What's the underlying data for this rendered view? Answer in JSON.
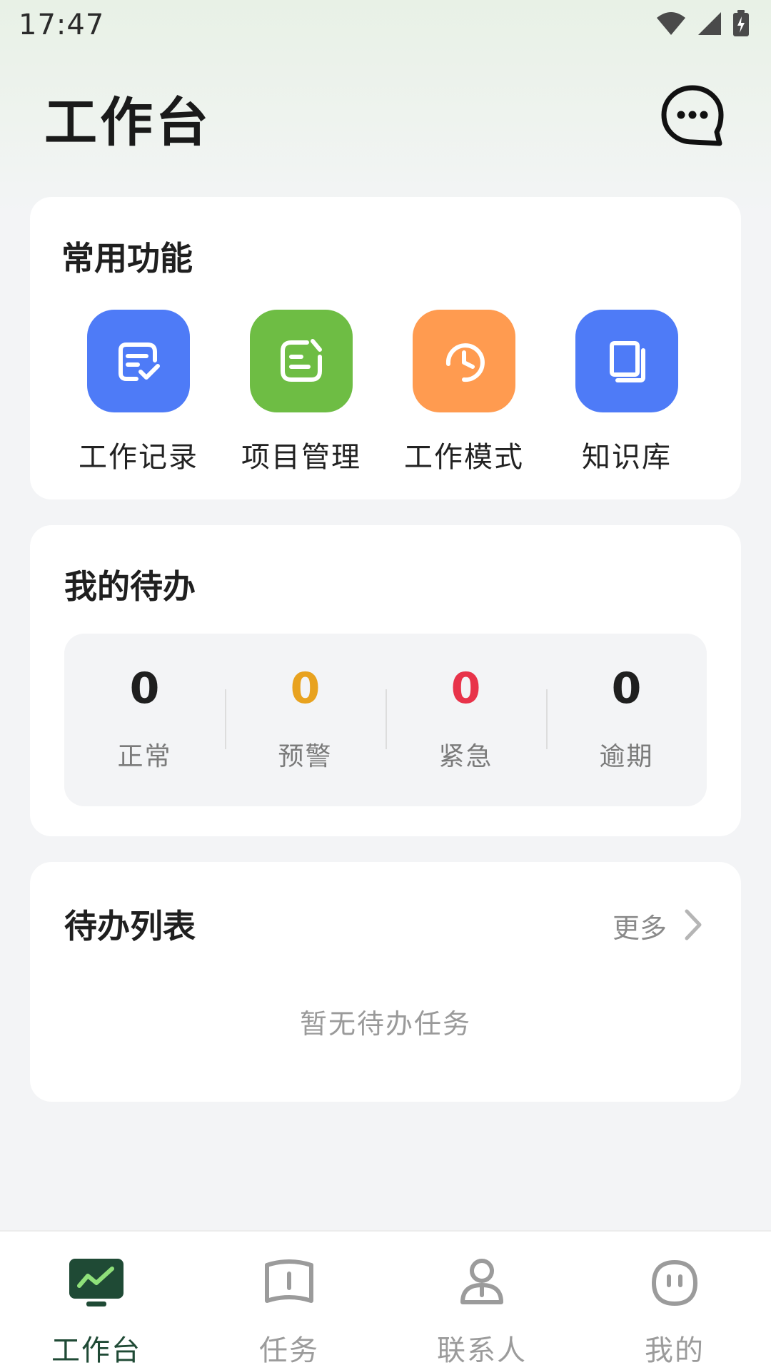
{
  "status_bar": {
    "time": "17:47"
  },
  "header": {
    "title": "工作台",
    "chat_icon": "chat-bubble-icon"
  },
  "functions": {
    "title": "常用功能",
    "items": [
      {
        "label": "工作记录",
        "icon": "record-check-icon",
        "color": "#4e7bf7"
      },
      {
        "label": "项目管理",
        "icon": "project-note-icon",
        "color": "#6ebd44"
      },
      {
        "label": "工作模式",
        "icon": "clock-icon",
        "color": "#ff9b50"
      },
      {
        "label": "知识库",
        "icon": "book-icon",
        "color": "#4e7bf7"
      }
    ]
  },
  "todo": {
    "title": "我的待办",
    "stats": [
      {
        "value": "0",
        "label": "正常",
        "color": "#1f1f1f"
      },
      {
        "value": "0",
        "label": "预警",
        "color": "#e8a21f"
      },
      {
        "value": "0",
        "label": "紧急",
        "color": "#e8334a"
      },
      {
        "value": "0",
        "label": "逾期",
        "color": "#1f1f1f"
      }
    ]
  },
  "todo_list": {
    "title": "待办列表",
    "more_label": "更多",
    "empty_text": "暂无待办任务"
  },
  "bottom_nav": {
    "items": [
      {
        "label": "工作台",
        "icon": "dashboard-icon",
        "active": true
      },
      {
        "label": "任务",
        "icon": "task-book-icon",
        "active": false
      },
      {
        "label": "联系人",
        "icon": "contact-person-icon",
        "active": false
      },
      {
        "label": "我的",
        "icon": "profile-face-icon",
        "active": false
      }
    ],
    "active_color": "#1f4a35"
  }
}
